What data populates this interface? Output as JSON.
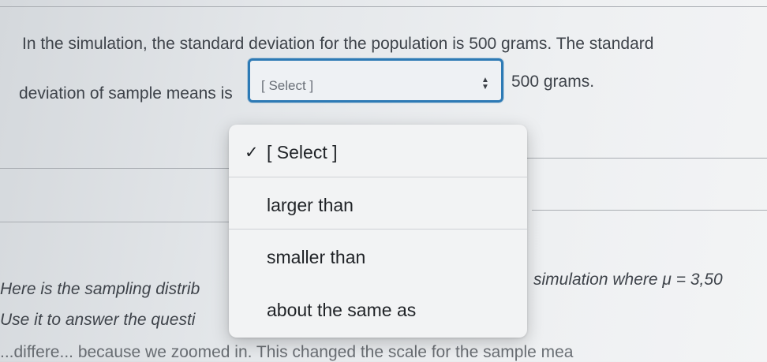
{
  "question": {
    "line1": "In the simulation, the standard deviation for the population is 500 grams. The standard",
    "line2_before": "deviation of sample means is",
    "line2_after": "500 grams."
  },
  "select": {
    "value": "[ Select ]",
    "arrows_icon": "up-down-chevron-icon",
    "options": [
      {
        "label": "[ Select ]",
        "checked": true
      },
      {
        "label": "larger than",
        "checked": false
      },
      {
        "label": "smaller than",
        "checked": false
      },
      {
        "label": "about the same as",
        "checked": false
      }
    ],
    "check_glyph": "✓"
  },
  "background_text": {
    "line_a_left": "Here is the sampling distrib",
    "line_a_right": "simulation where μ = 3,50",
    "line_b_left": "Use it to answer the questi",
    "line_c": "...differe... because we zoomed in. This changed the scale for the sample mea"
  },
  "colors": {
    "focus_border": "#2d7ab5",
    "dropdown_bg": "#f2f3f4"
  }
}
